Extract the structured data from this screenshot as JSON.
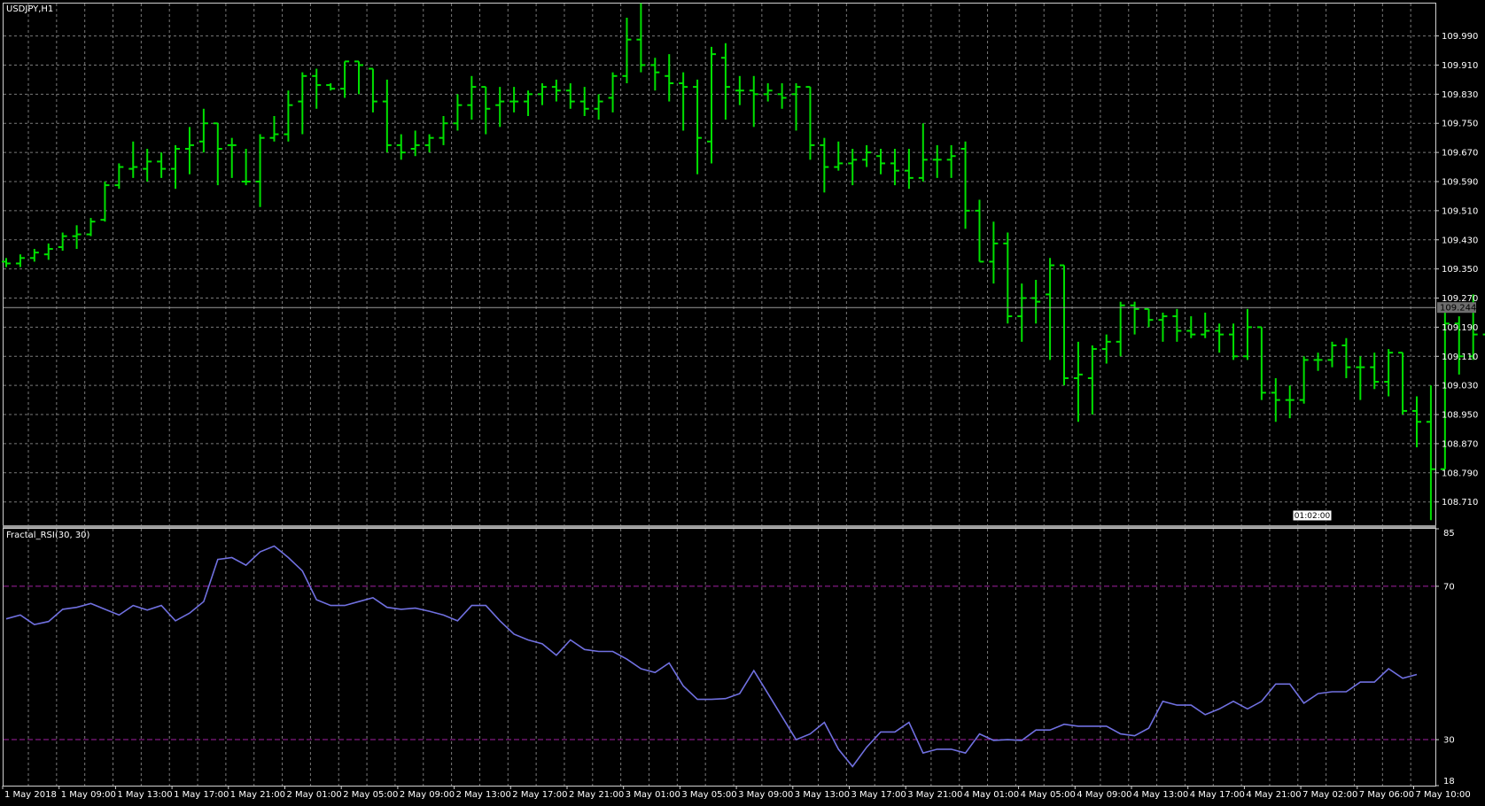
{
  "window_title": "USDJPY,H1",
  "indicator_title": "Fractal_RSI(30, 30)",
  "colors": {
    "background": "#000000",
    "grid": "#7a7a7a",
    "bar": "#00e000",
    "rsi_line": "#7070e0",
    "level_line": "#a020a0",
    "price_tag": "#6e6e6e"
  },
  "current_price": "109.244",
  "time_marker": "01:02:00",
  "chart_data": [
    {
      "type": "ohlc",
      "symbol": "USDJPY",
      "timeframe": "H1",
      "ylim": [
        108.646,
        110.079
      ],
      "y_ticks": [
        "109.990",
        "109.910",
        "109.830",
        "109.750",
        "109.670",
        "109.590",
        "109.510",
        "109.430",
        "109.350",
        "109.270",
        "109.190",
        "109.110",
        "109.030",
        "108.950",
        "108.870",
        "108.790",
        "108.710"
      ],
      "x_ticks": [
        "1 May 2018",
        "1 May 09:00",
        "1 May 13:00",
        "1 May 17:00",
        "1 May 21:00",
        "2 May 01:00",
        "2 May 05:00",
        "2 May 09:00",
        "2 May 13:00",
        "2 May 17:00",
        "2 May 21:00",
        "3 May 01:00",
        "3 May 05:00",
        "3 May 09:00",
        "3 May 13:00",
        "3 May 17:00",
        "3 May 21:00",
        "4 May 01:00",
        "4 May 05:00",
        "4 May 09:00",
        "4 May 13:00",
        "4 May 17:00",
        "4 May 21:00",
        "7 May 02:00",
        "7 May 06:00",
        "7 May 10:00"
      ],
      "bars": [
        [
          109.37,
          109.38,
          109.355,
          109.365
        ],
        [
          109.365,
          109.39,
          109.355,
          109.38
        ],
        [
          109.38,
          109.405,
          109.37,
          109.395
        ],
        [
          109.39,
          109.42,
          109.375,
          109.405
        ],
        [
          109.41,
          109.45,
          109.4,
          109.44
        ],
        [
          109.44,
          109.47,
          109.405,
          109.445
        ],
        [
          109.445,
          109.49,
          109.44,
          109.48
        ],
        [
          109.485,
          109.59,
          109.48,
          109.58
        ],
        [
          109.58,
          109.64,
          109.57,
          109.63
        ],
        [
          109.625,
          109.7,
          109.6,
          109.63
        ],
        [
          109.625,
          109.68,
          109.59,
          109.645
        ],
        [
          109.645,
          109.67,
          109.6,
          109.625
        ],
        [
          109.625,
          109.69,
          109.57,
          109.68
        ],
        [
          109.68,
          109.74,
          109.61,
          109.69
        ],
        [
          109.7,
          109.79,
          109.67,
          109.75
        ],
        [
          109.75,
          109.75,
          109.58,
          109.68
        ],
        [
          109.69,
          109.71,
          109.6,
          109.69
        ],
        [
          109.59,
          109.68,
          109.58,
          109.59
        ],
        [
          109.59,
          109.72,
          109.52,
          109.71
        ],
        [
          109.71,
          109.77,
          109.7,
          109.72
        ],
        [
          109.72,
          109.84,
          109.7,
          109.8
        ],
        [
          109.81,
          109.89,
          109.72,
          109.88
        ],
        [
          109.88,
          109.9,
          109.79,
          109.855
        ],
        [
          109.855,
          109.86,
          109.84,
          109.845
        ],
        [
          109.845,
          109.92,
          109.82,
          109.92
        ],
        [
          109.92,
          109.92,
          109.83,
          109.91
        ],
        [
          109.9,
          109.9,
          109.78,
          109.81
        ],
        [
          109.81,
          109.87,
          109.67,
          109.69
        ],
        [
          109.69,
          109.72,
          109.65,
          109.67
        ],
        [
          109.68,
          109.73,
          109.66,
          109.69
        ],
        [
          109.69,
          109.72,
          109.67,
          109.71
        ],
        [
          109.71,
          109.77,
          109.69,
          109.75
        ],
        [
          109.75,
          109.83,
          109.73,
          109.8
        ],
        [
          109.8,
          109.88,
          109.76,
          109.85
        ],
        [
          109.85,
          109.85,
          109.72,
          109.79
        ],
        [
          109.8,
          109.85,
          109.74,
          109.81
        ],
        [
          109.81,
          109.85,
          109.78,
          109.81
        ],
        [
          109.81,
          109.84,
          109.77,
          109.83
        ],
        [
          109.83,
          109.86,
          109.8,
          109.85
        ],
        [
          109.85,
          109.87,
          109.81,
          109.84
        ],
        [
          109.84,
          109.86,
          109.79,
          109.81
        ],
        [
          109.81,
          109.85,
          109.77,
          109.79
        ],
        [
          109.79,
          109.83,
          109.76,
          109.81
        ],
        [
          109.82,
          109.89,
          109.78,
          109.88
        ],
        [
          109.88,
          110.04,
          109.86,
          109.98
        ],
        [
          109.98,
          110.08,
          109.89,
          109.91
        ],
        [
          109.91,
          109.93,
          109.84,
          109.89
        ],
        [
          109.88,
          109.94,
          109.81,
          109.86
        ],
        [
          109.86,
          109.89,
          109.73,
          109.85
        ],
        [
          109.85,
          109.87,
          109.61,
          109.71
        ],
        [
          109.7,
          109.96,
          109.64,
          109.94
        ],
        [
          109.93,
          109.97,
          109.76,
          109.85
        ],
        [
          109.84,
          109.88,
          109.8,
          109.84
        ],
        [
          109.84,
          109.88,
          109.74,
          109.83
        ],
        [
          109.83,
          109.86,
          109.81,
          109.84
        ],
        [
          109.83,
          109.86,
          109.79,
          109.82
        ],
        [
          109.83,
          109.86,
          109.73,
          109.85
        ],
        [
          109.85,
          109.85,
          109.65,
          109.69
        ],
        [
          109.69,
          109.71,
          109.56,
          109.63
        ],
        [
          109.63,
          109.7,
          109.62,
          109.64
        ],
        [
          109.64,
          109.68,
          109.58,
          109.65
        ],
        [
          109.65,
          109.69,
          109.63,
          109.67
        ],
        [
          109.66,
          109.68,
          109.61,
          109.64
        ],
        [
          109.64,
          109.68,
          109.58,
          109.62
        ],
        [
          109.62,
          109.68,
          109.57,
          109.6
        ],
        [
          109.6,
          109.75,
          109.59,
          109.65
        ],
        [
          109.65,
          109.69,
          109.6,
          109.65
        ],
        [
          109.65,
          109.69,
          109.6,
          109.66
        ],
        [
          109.68,
          109.7,
          109.46,
          109.51
        ],
        [
          109.51,
          109.54,
          109.37,
          109.37
        ],
        [
          109.37,
          109.48,
          109.31,
          109.42
        ],
        [
          109.42,
          109.45,
          109.2,
          109.22
        ],
        [
          109.22,
          109.31,
          109.15,
          109.27
        ],
        [
          109.27,
          109.32,
          109.2,
          109.26
        ],
        [
          109.28,
          109.38,
          109.1,
          109.36
        ],
        [
          109.36,
          109.36,
          109.03,
          109.05
        ],
        [
          109.05,
          109.15,
          108.93,
          109.06
        ],
        [
          109.05,
          109.14,
          108.95,
          109.13
        ],
        [
          109.13,
          109.17,
          109.09,
          109.15
        ],
        [
          109.15,
          109.26,
          109.11,
          109.25
        ],
        [
          109.25,
          109.26,
          109.17,
          109.24
        ],
        [
          109.24,
          109.24,
          109.19,
          109.21
        ],
        [
          109.21,
          109.23,
          109.15,
          109.22
        ],
        [
          109.22,
          109.24,
          109.15,
          109.18
        ],
        [
          109.18,
          109.22,
          109.16,
          109.17
        ],
        [
          109.17,
          109.23,
          109.16,
          109.18
        ],
        [
          109.18,
          109.2,
          109.12,
          109.17
        ],
        [
          109.17,
          109.2,
          109.1,
          109.11
        ],
        [
          109.11,
          109.24,
          109.1,
          109.19
        ],
        [
          109.19,
          109.19,
          108.99,
          109.01
        ],
        [
          109.01,
          109.05,
          108.93,
          108.99
        ],
        [
          108.99,
          109.03,
          108.94,
          108.99
        ],
        [
          108.99,
          109.11,
          108.98,
          109.1
        ],
        [
          109.1,
          109.12,
          109.07,
          109.1
        ],
        [
          109.1,
          109.15,
          109.08,
          109.14
        ],
        [
          109.14,
          109.16,
          109.05,
          109.08
        ],
        [
          109.08,
          109.11,
          108.99,
          109.08
        ],
        [
          109.08,
          109.12,
          109.02,
          109.04
        ],
        [
          109.04,
          109.13,
          109.0,
          109.12
        ],
        [
          109.12,
          109.12,
          108.95,
          108.96
        ],
        [
          108.96,
          109.0,
          108.86,
          108.93
        ],
        [
          108.93,
          109.03,
          108.66,
          108.8
        ],
        [
          108.8,
          109.24,
          108.8,
          109.2
        ],
        [
          109.2,
          109.22,
          109.06,
          109.11
        ],
        [
          109.11,
          109.28,
          109.1,
          109.17
        ],
        [
          109.17,
          109.23,
          108.95,
          108.97
        ],
        [
          108.97,
          109.15,
          108.96,
          109.09
        ],
        [
          109.09,
          109.14,
          109.08,
          109.11
        ],
        [
          109.1,
          109.16,
          109.08,
          109.1
        ],
        [
          109.1,
          109.14,
          109.06,
          109.09
        ],
        [
          109.09,
          109.12,
          109.03,
          109.1
        ],
        [
          109.1,
          109.1,
          109.04,
          109.08
        ],
        [
          109.08,
          109.11,
          109.06,
          109.08
        ],
        [
          109.08,
          109.2,
          109.05,
          109.14
        ],
        [
          109.14,
          109.17,
          108.88,
          108.91
        ],
        [
          108.91,
          108.93,
          108.76,
          108.92
        ],
        [
          108.92,
          108.97,
          108.9,
          108.94
        ],
        [
          108.94,
          108.99,
          108.87,
          108.97
        ],
        [
          108.97,
          108.99,
          108.94,
          108.98
        ],
        [
          108.98,
          109.13,
          108.95,
          109.13
        ],
        [
          109.13,
          109.14,
          109.12,
          109.13
        ],
        [
          109.13,
          109.21,
          109.11,
          109.17
        ],
        [
          109.17,
          109.27,
          109.15,
          109.22
        ],
        [
          109.22,
          109.34,
          109.18,
          109.2
        ],
        [
          109.2,
          109.25,
          109.19,
          109.25
        ]
      ]
    },
    {
      "type": "line",
      "name": "Fractal_RSI(30, 30)",
      "ylim": [
        18,
        85
      ],
      "y_ticks": [
        "85",
        "70",
        "30",
        "18"
      ],
      "levels": [
        70,
        30
      ],
      "values": [
        61.5,
        62.5,
        60,
        60.8,
        64,
        64.5,
        65.5,
        64,
        62.5,
        65,
        63.8,
        65,
        61,
        63,
        66,
        77,
        77.5,
        75.5,
        79,
        80.5,
        77.5,
        74,
        66.5,
        65,
        65,
        66,
        67,
        64.5,
        64,
        64.3,
        63.5,
        62.5,
        61,
        65,
        65,
        61,
        57.5,
        56,
        55,
        52,
        56,
        53.5,
        53,
        53,
        51,
        48.5,
        47.5,
        50,
        44,
        40.5,
        40.5,
        40.7,
        42,
        48,
        42,
        36,
        30,
        31.5,
        34.5,
        27.5,
        23,
        28,
        32,
        32,
        34.5,
        26.5,
        27.5,
        27.5,
        26.5,
        31.5,
        29.8,
        30,
        29.8,
        32.5,
        32.5,
        34,
        33.5,
        33.5,
        33.5,
        31.5,
        31,
        33,
        40,
        39,
        39,
        36.5,
        38,
        40,
        38,
        40,
        44.5,
        44.5,
        39.5,
        42,
        42.5,
        42.5,
        45,
        45,
        48.5,
        46,
        47
      ]
    }
  ]
}
